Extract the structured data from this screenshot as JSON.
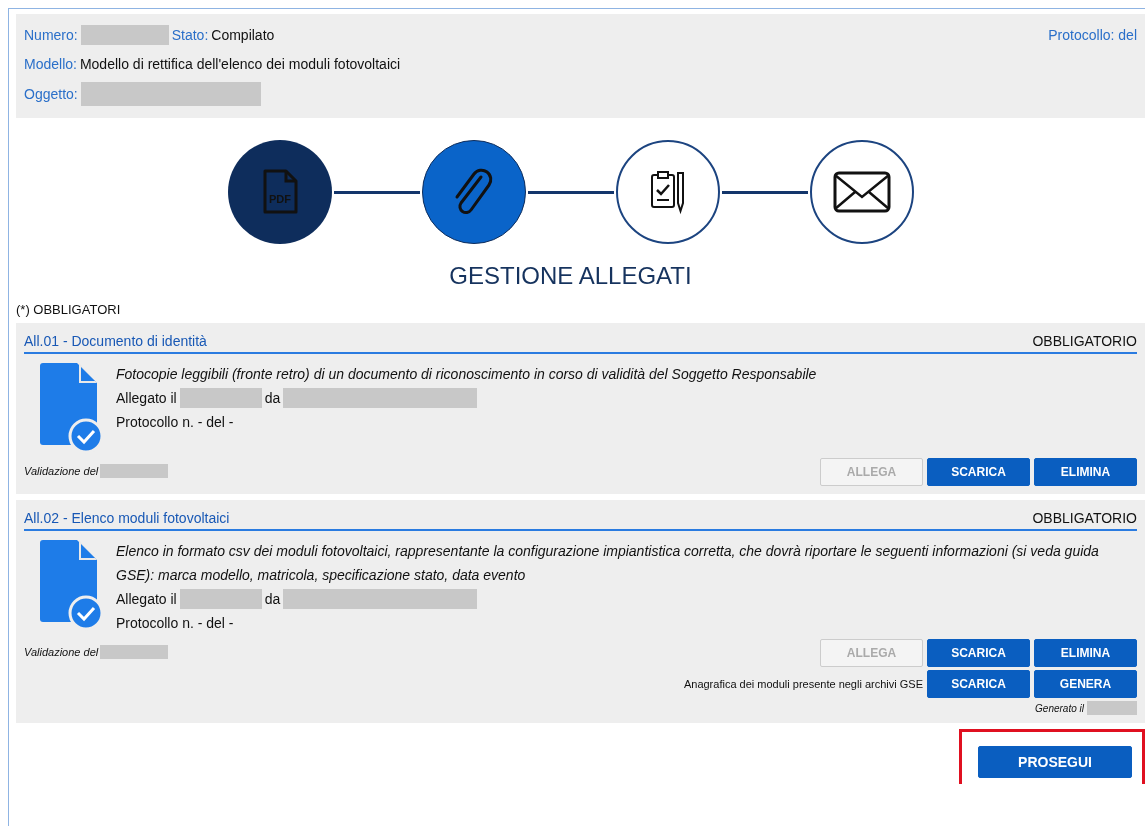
{
  "header": {
    "numero_label": "Numero:",
    "stato_label": "Stato:",
    "stato_value": "Compilato",
    "protocollo_label": "Protocollo: del",
    "modello_label": "Modello:",
    "modello_value": "Modello di rettifica dell'elenco dei moduli fotovoltaici",
    "oggetto_label": "Oggetto:"
  },
  "steps": [
    {
      "kind": "pdf",
      "completed": true,
      "selected": false,
      "icon_text": "PDF"
    },
    {
      "kind": "paperclip",
      "completed": false,
      "selected": true
    },
    {
      "kind": "clipboard",
      "completed": false,
      "selected": false
    },
    {
      "kind": "envelope",
      "completed": false,
      "selected": false
    }
  ],
  "title": "GESTIONE ALLEGATI",
  "legend": "(*) OBBLIGATORI",
  "attachments": [
    {
      "title": "All.01 - Documento di identità",
      "badge": "OBBLIGATORIO",
      "description": "Fotocopie leggibili (fronte retro) di un documento di riconoscimento in corso di validità del Soggetto Responsabile",
      "allegato_label": "Allegato il",
      "da_label": "da",
      "protocollo": "Protocollo n. - del -",
      "validazione": "Validazione del",
      "buttons": [
        {
          "label": "ALLEGA",
          "disabled": true
        },
        {
          "label": "SCARICA",
          "disabled": false
        },
        {
          "label": "ELIMINA",
          "disabled": false
        }
      ]
    },
    {
      "title": "All.02 - Elenco moduli fotovoltaici",
      "badge": "OBBLIGATORIO",
      "description": "Elenco in formato csv dei moduli fotovoltaici, rappresentante la configurazione impiantistica corretta, che dovrà riportare le seguenti informazioni (si veda guida GSE): marca modello, matricola, specificazione stato, data evento",
      "allegato_label": "Allegato il",
      "da_label": "da",
      "protocollo": "Protocollo n. - del -",
      "validazione": "Validazione del",
      "buttons": [
        {
          "label": "ALLEGA",
          "disabled": true
        },
        {
          "label": "SCARICA",
          "disabled": false
        },
        {
          "label": "ELIMINA",
          "disabled": false
        }
      ],
      "extra": {
        "label": "Anagrafica dei moduli presente negli archivi GSE",
        "buttons": [
          {
            "label": "SCARICA",
            "disabled": false
          },
          {
            "label": "GENERA",
            "disabled": false
          }
        ],
        "generato": "Generato il"
      }
    }
  ],
  "footer": {
    "button": "PROSEGUI",
    "highlighted": true
  }
}
